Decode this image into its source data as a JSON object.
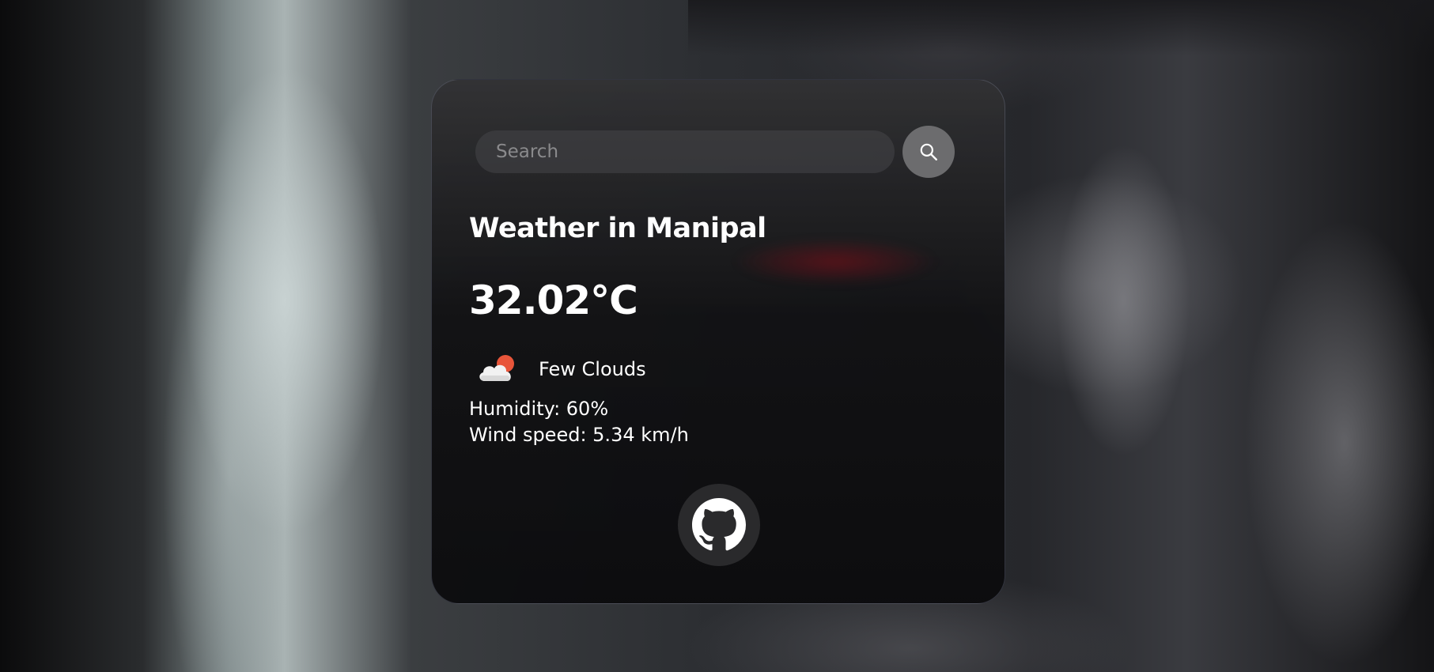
{
  "search": {
    "placeholder": "Search",
    "value": ""
  },
  "weather": {
    "title": "Weather in Manipal",
    "temperature": "32.02°C",
    "condition": "Few Clouds",
    "humidity": "Humidity: 60%",
    "wind": "Wind speed: 5.34 km/h"
  },
  "icons": {
    "search": "search-icon",
    "weather": "few-clouds-icon",
    "github": "github-icon"
  },
  "colors": {
    "card_background": "#141416",
    "search_button": "#6c6c6e",
    "text": "#ffffff",
    "sun": "#e8553a"
  }
}
